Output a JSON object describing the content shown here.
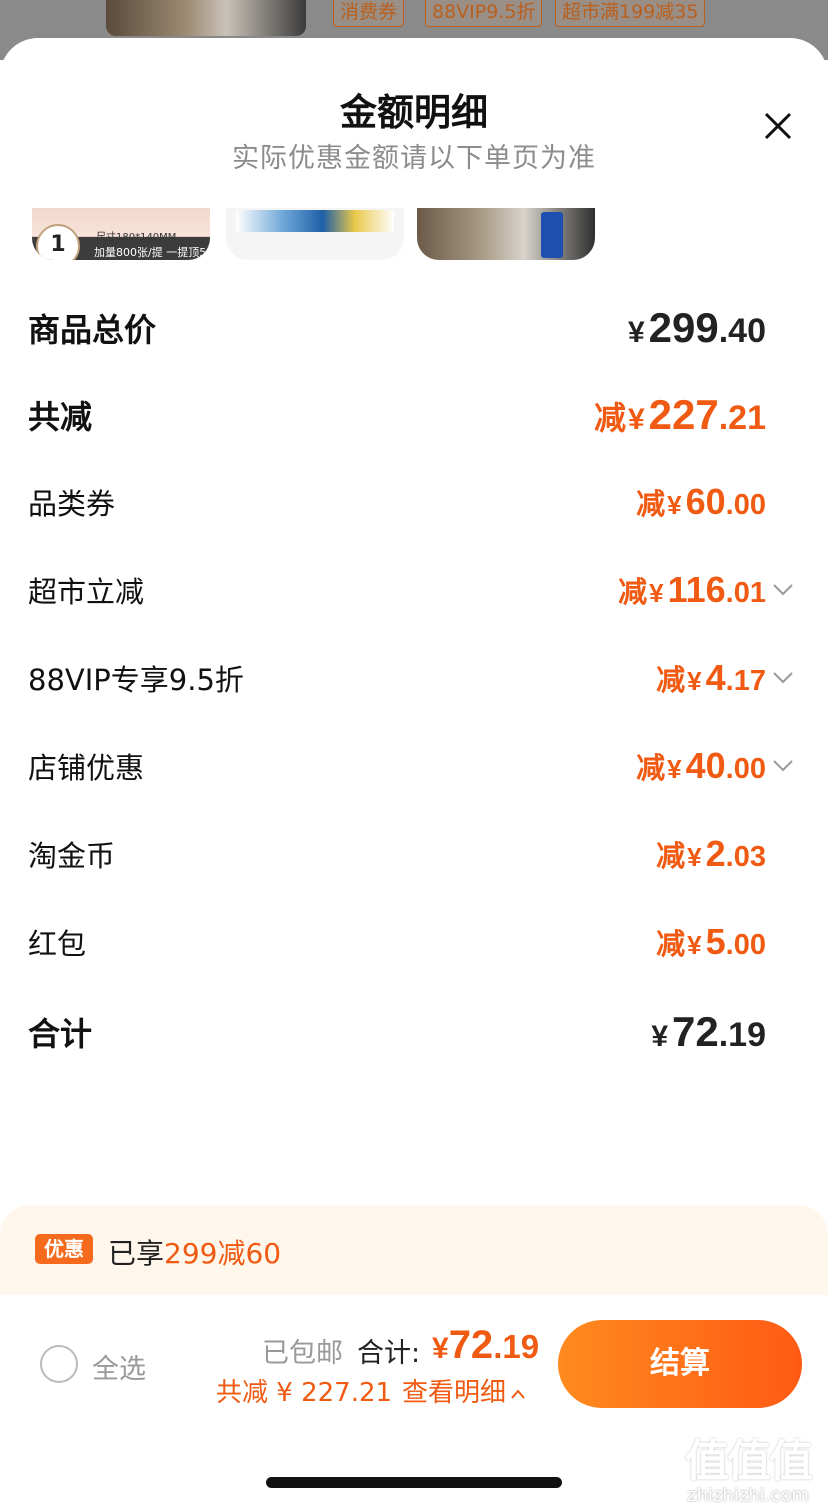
{
  "background": {
    "tags": [
      "消费券",
      "88VIP9.5折",
      "超市满199减35"
    ]
  },
  "header": {
    "title": "金额明细",
    "subtitle": "实际优惠金额请以下单页为准"
  },
  "thumbnails": {
    "t1_badge": "1",
    "t1_text1": "尺寸180*140MM",
    "t1_text2": "加量800张/提 一提顶5"
  },
  "rows": {
    "total_price": {
      "label": "商品总价",
      "prefix": "",
      "yen": "¥",
      "int": "299",
      "dec": ".40"
    },
    "total_discount": {
      "label": "共减",
      "prefix": "减",
      "yen": "¥",
      "int": "227",
      "dec": ".21"
    },
    "category_coupon": {
      "label": "品类券",
      "prefix": "减",
      "yen": "¥",
      "int": "60",
      "dec": ".00"
    },
    "supermarket": {
      "label": "超市立减",
      "prefix": "减",
      "yen": "¥",
      "int": "116",
      "dec": ".01"
    },
    "vip": {
      "label": "88VIP专享9.5折",
      "prefix": "减",
      "yen": "¥",
      "int": "4",
      "dec": ".17"
    },
    "store": {
      "label": "店铺优惠",
      "prefix": "减",
      "yen": "¥",
      "int": "40",
      "dec": ".00"
    },
    "coins": {
      "label": "淘金币",
      "prefix": "减",
      "yen": "¥",
      "int": "2",
      "dec": ".03"
    },
    "redpacket": {
      "label": "红包",
      "prefix": "减",
      "yen": "¥",
      "int": "5",
      "dec": ".00"
    },
    "subtotal": {
      "label": "合计",
      "prefix": "",
      "yen": "¥",
      "int": "72",
      "dec": ".19"
    }
  },
  "promo": {
    "tag": "优惠",
    "text": "已享",
    "highlight": "299减60"
  },
  "footer": {
    "select_all": "全选",
    "shipping": "已包邮",
    "total_label": "合计:",
    "total_yen": "¥",
    "total_int": "72",
    "total_dec": ".19",
    "saved": "共减 ¥ 227.21",
    "detail_link": "查看明细",
    "checkout": "结算"
  },
  "watermark": {
    "logo": "值值值",
    "url": "zhizhizhi.com"
  },
  "colors": {
    "accent": "#f05a12",
    "checkout_start": "#ff8a1e",
    "checkout_end": "#ff5a14",
    "promo_bg": "#fff6ec"
  }
}
